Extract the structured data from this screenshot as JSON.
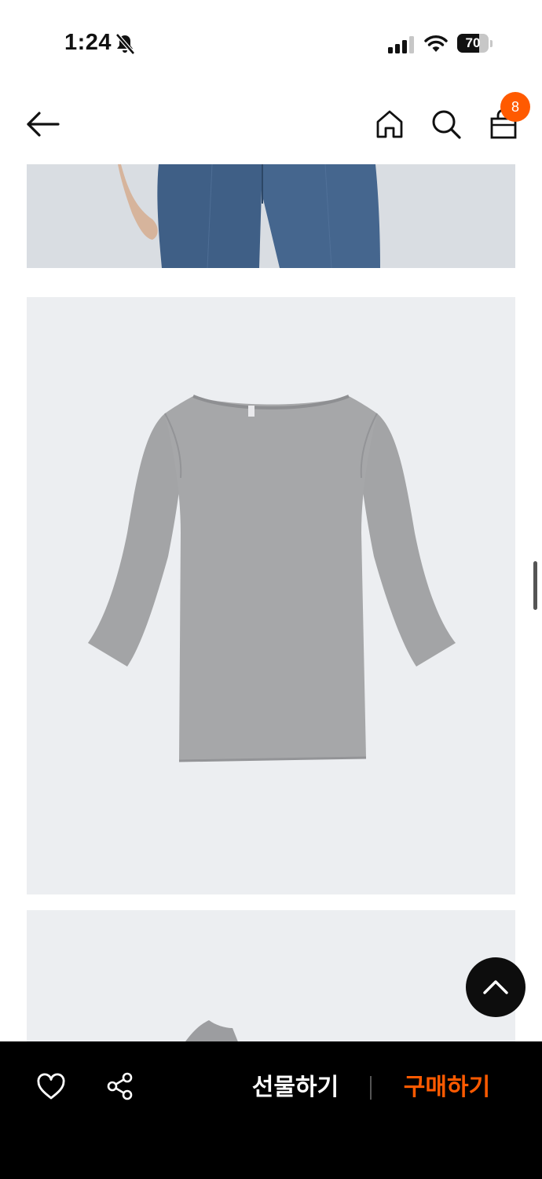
{
  "status_bar": {
    "time": "1:24",
    "battery_level": "70",
    "icons": [
      "bell-off-icon",
      "cellular-signal-icon",
      "wifi-icon",
      "battery-icon"
    ]
  },
  "header": {
    "back_icon": "arrow-left-icon",
    "home_icon": "home-icon",
    "search_icon": "search-icon",
    "cart_icon": "shopping-bag-icon",
    "cart_count": "8"
  },
  "content": {
    "images": [
      "model-jeans-photo",
      "grey-boatneck-tee-photo",
      "garment-detail-photo"
    ]
  },
  "scroll_to_top_icon": "chevron-up-icon",
  "bottom_bar": {
    "wish_icon": "heart-icon",
    "share_icon": "share-icon",
    "gift_label": "선물하기",
    "buy_label": "구매하기"
  },
  "colors": {
    "accent": "#ff5a00",
    "bottom_bar_bg": "#000000",
    "image_bg": "#eceef1"
  }
}
